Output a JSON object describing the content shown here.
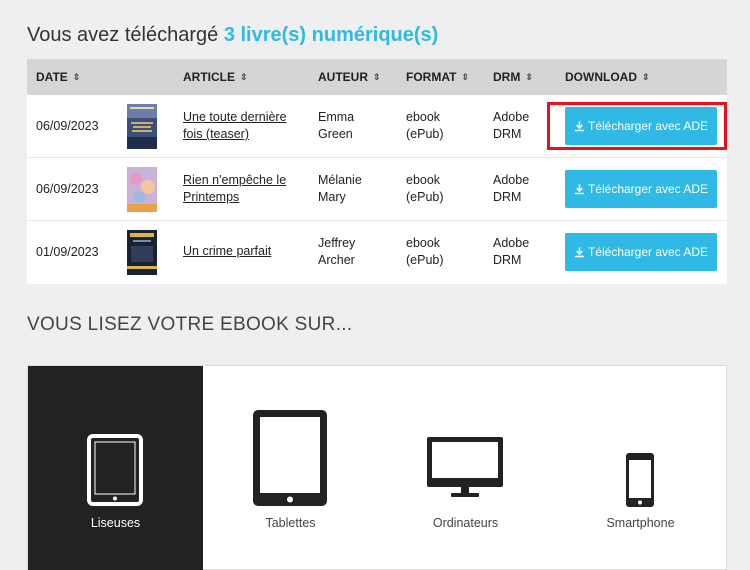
{
  "header": {
    "prefix": "Vous avez téléchargé",
    "count_label": "3 livre(s) numérique(s)"
  },
  "table": {
    "columns": {
      "date": "DATE",
      "article": "ARTICLE",
      "author": "AUTEUR",
      "format": "FORMAT",
      "drm": "DRM",
      "download": "DOWNLOAD"
    },
    "rows": [
      {
        "date": "06/09/2023",
        "article": "Une toute dernière fois (teaser)",
        "author": "Emma Green",
        "format": "ebook (ePub)",
        "drm": "Adobe DRM",
        "button": "Télécharger avec ADE"
      },
      {
        "date": "06/09/2023",
        "article": "Rien n'empêche le Printemps",
        "author": "Mélanie Mary",
        "format": "ebook (ePub)",
        "drm": "Adobe DRM",
        "button": "Télécharger avec ADE"
      },
      {
        "date": "01/09/2023",
        "article": "Un crime parfait",
        "author": "Jeffrey Archer",
        "format": "ebook (ePub)",
        "drm": "Adobe DRM",
        "button": "Télécharger avec ADE"
      }
    ]
  },
  "section_title": "VOUS LISEZ VOTRE EBOOK SUR...",
  "devices": {
    "liseuses": "Liseuses",
    "tablettes": "Tablettes",
    "ordinateurs": "Ordinateurs",
    "smartphone": "Smartphone"
  },
  "colors": {
    "accent": "#2fb9e4",
    "highlight": "#e4131d",
    "active_device_bg": "#222222"
  },
  "icons": [
    "sort-icon",
    "download-icon",
    "ereader-icon",
    "tablet-icon",
    "monitor-icon",
    "smartphone-icon"
  ]
}
